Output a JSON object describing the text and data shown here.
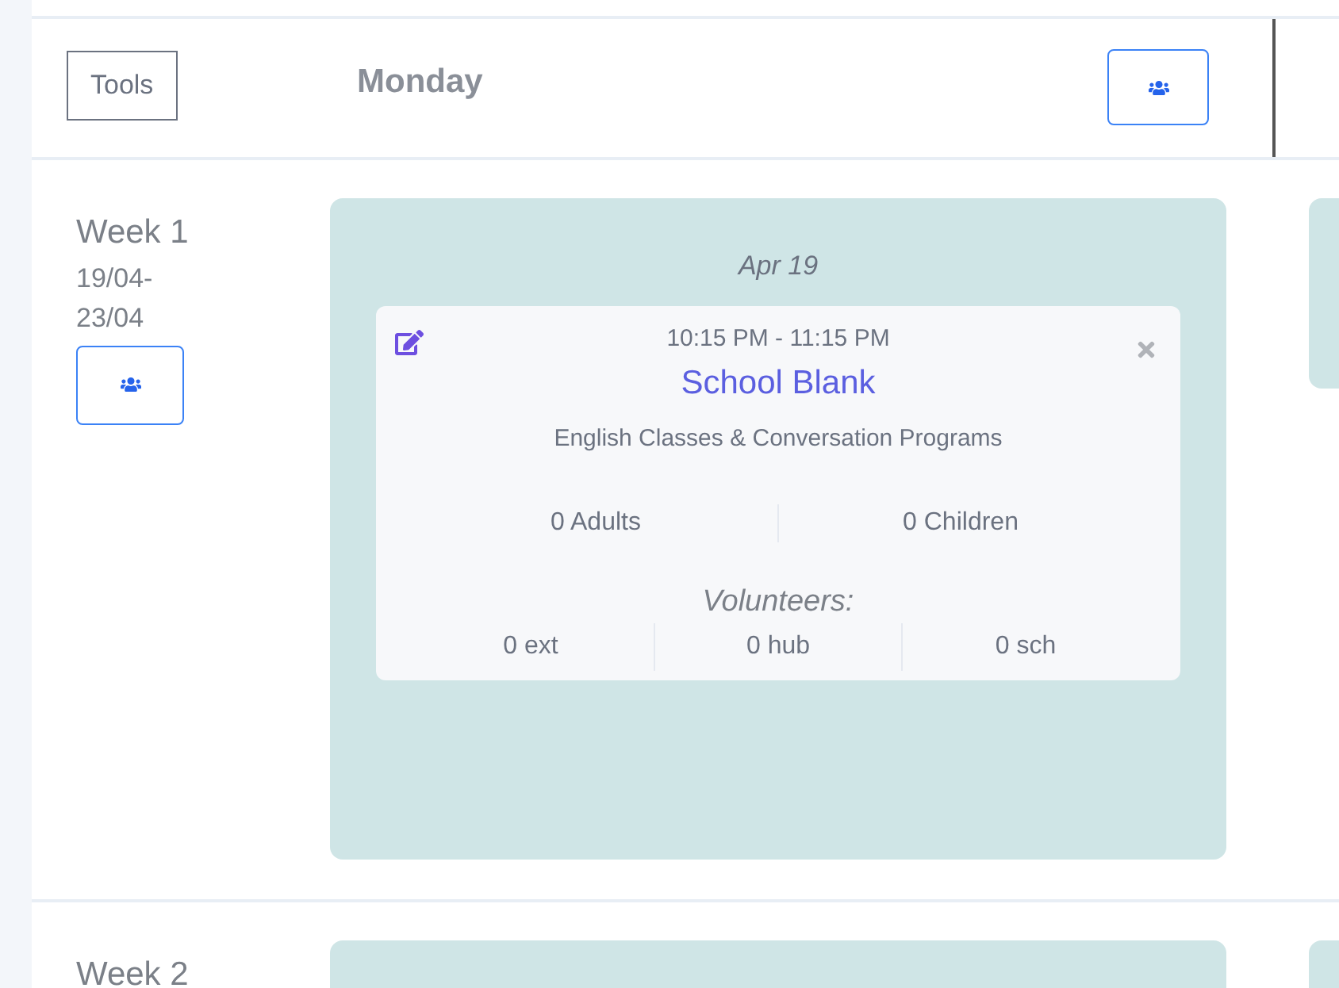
{
  "header": {
    "tools_button": "Tools",
    "day": "Monday"
  },
  "weeks": [
    {
      "label": "Week 1",
      "range_start": "19/04-",
      "range_end": "23/04",
      "days": [
        {
          "date": "Apr 19",
          "events": [
            {
              "time": "10:15 PM - 11:15 PM",
              "title": "School Blank",
              "program": "English Classes & Conversation Programs",
              "attendance": [
                "0 Adults",
                "0 Children"
              ],
              "volunteers_label": "Volunteers:",
              "volunteers": [
                "0 ext",
                "0 hub",
                "0 sch"
              ]
            }
          ]
        }
      ]
    },
    {
      "label": "Week 2"
    }
  ]
}
